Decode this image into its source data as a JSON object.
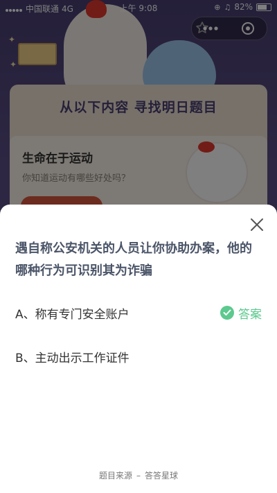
{
  "status_bar": {
    "carrier": "中国联通",
    "network": "4G",
    "time": "上午 9:08",
    "battery": "82%",
    "battery_level": 0.82
  },
  "capsule": {
    "star_icon": "star-outline-icon",
    "more_icon": "more-dots-icon",
    "close_icon": "close-circle-icon"
  },
  "background_card": {
    "title": "从以下内容  寻找明日题目",
    "topic_title": "生命在于运动",
    "topic_desc": "你知道运动有哪些好处吗？"
  },
  "sheet": {
    "question": "遇自称公安机关的人员让你协助办案，他的哪种行为可识别其为诈骗",
    "options": [
      {
        "label": "A、称有专门安全账户",
        "is_answer": true
      },
      {
        "label": "B、主动出示工作证件",
        "is_answer": false
      }
    ],
    "answer_label": "答案",
    "source_prefix": "题目来源",
    "source_dash": "–",
    "source_name": "答答星球"
  },
  "colors": {
    "accent_green": "#5cc98e",
    "question_text": "#4b5568",
    "header_purple": "#4a3f73"
  }
}
